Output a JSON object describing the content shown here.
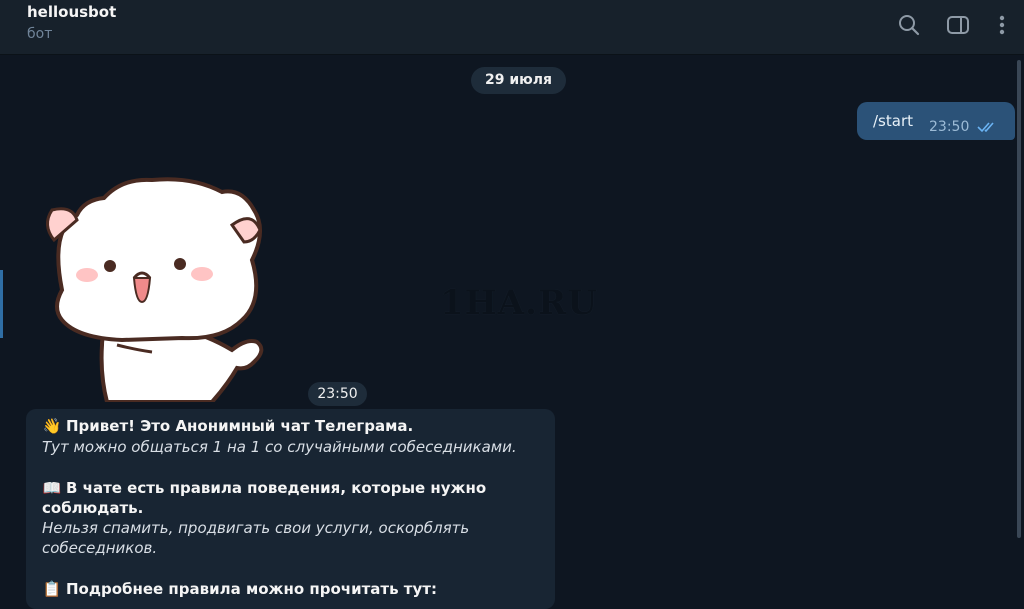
{
  "header": {
    "title": "hellousbot",
    "subtitle": "бот",
    "icons": [
      "search-icon",
      "sidebar-toggle-icon",
      "more-vertical-icon"
    ]
  },
  "chat": {
    "date_label": "29 июля",
    "outgoing": {
      "text": "/start",
      "time": "23:50",
      "status": "read-double-check"
    },
    "sticker": {
      "time": "23:50"
    },
    "watermark": "1HA.RU",
    "incoming": {
      "greeting_emoji": "👋",
      "greeting": "Привет! Это Анонимный чат Телеграма.",
      "greeting_sub": "Тут можно общаться 1 на 1 со случайными собеседниками.",
      "rules_emoji": "📖",
      "rules_line1": "В чате есть правила поведения, которые нужно",
      "rules_line2": "соблюдать.",
      "rules_sub_line1": "Нельзя спамить, продвигать свои услуги, оскорблять",
      "rules_sub_line2": "собеседников.",
      "more_emoji": "📋",
      "more": "Подробнее правила можно прочитать тут:"
    }
  },
  "colors": {
    "background": "#0e1621",
    "header": "#17212b",
    "outgoing_bubble": "#2b5278",
    "incoming_bubble": "#182533",
    "read_check": "#6ab3f3"
  }
}
